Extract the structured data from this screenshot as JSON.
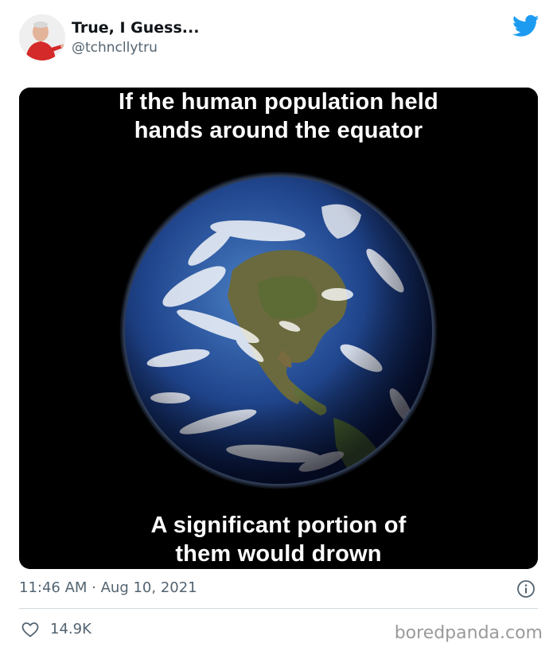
{
  "author": {
    "display_name": "True, I Guess...",
    "handle": "@tchncllytru"
  },
  "media": {
    "caption_top_line1": "If the human population held",
    "caption_top_line2": "hands around the equator",
    "caption_bottom_line1": "A significant portion of",
    "caption_bottom_line2": "them would drown"
  },
  "meta": {
    "timestamp": "11:46 AM · Aug 10, 2021"
  },
  "actions": {
    "like_count": "14.9K"
  },
  "watermark": "boredpanda.com",
  "icons": {
    "twitter": "twitter-bird-icon",
    "info": "info-icon",
    "like": "heart-icon"
  },
  "colors": {
    "twitter_blue": "#1d9bf0",
    "secondary_text": "#536471",
    "divider": "#cfd9de"
  }
}
